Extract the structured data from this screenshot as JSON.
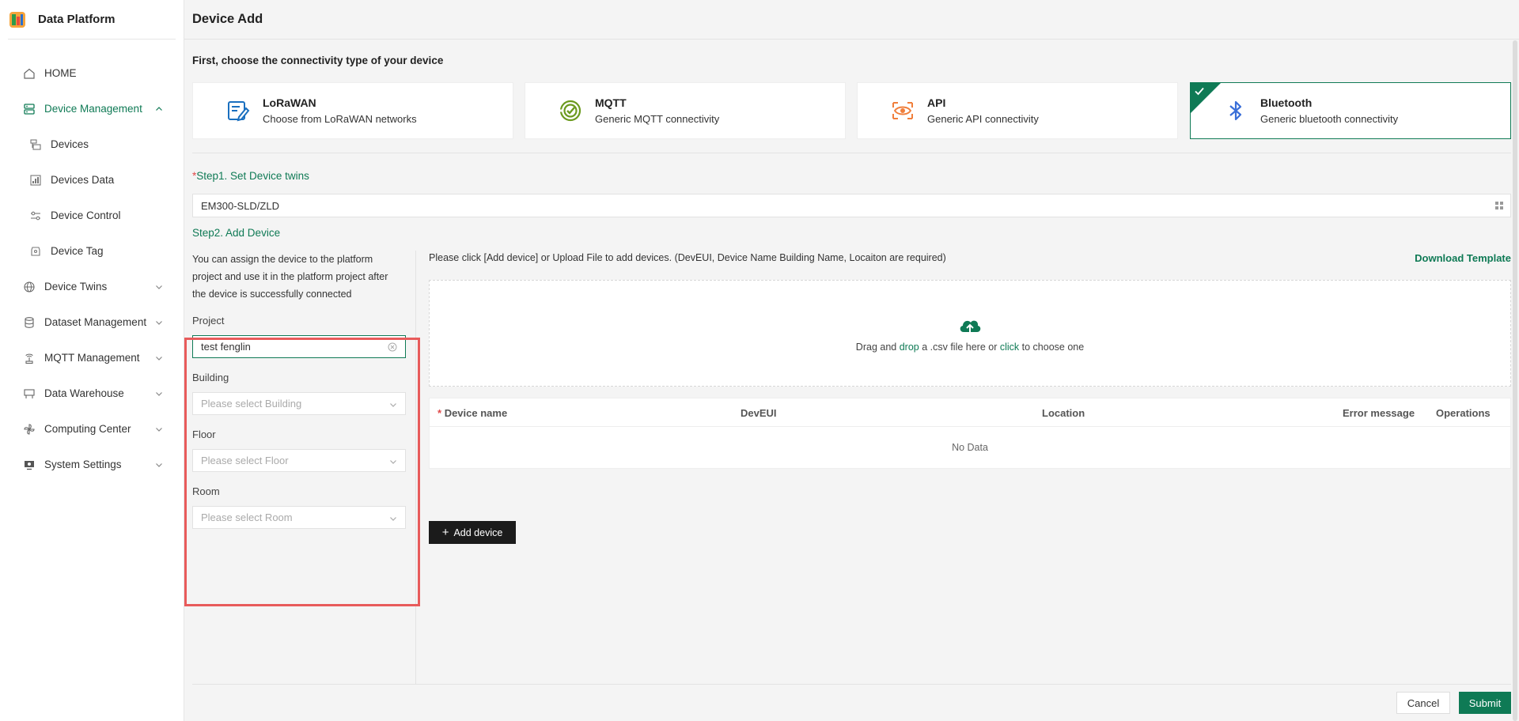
{
  "app": {
    "name": "Data Platform"
  },
  "sidebar": {
    "items": [
      {
        "label": "HOME",
        "icon": "home-icon"
      },
      {
        "label": "Device Management",
        "icon": "server-icon",
        "expanded": true
      },
      {
        "label": "Devices",
        "icon": "devices-icon"
      },
      {
        "label": "Devices Data",
        "icon": "data-icon"
      },
      {
        "label": "Device Control",
        "icon": "sliders-icon"
      },
      {
        "label": "Device Tag",
        "icon": "tag-icon"
      },
      {
        "label": "Device Twins",
        "icon": "globe-icon"
      },
      {
        "label": "Dataset Management",
        "icon": "database-icon"
      },
      {
        "label": "MQTT Management",
        "icon": "antenna-icon"
      },
      {
        "label": "Data Warehouse",
        "icon": "warehouse-icon"
      },
      {
        "label": "Computing Center",
        "icon": "pinwheel-icon"
      },
      {
        "label": "System Settings",
        "icon": "monitor-icon"
      }
    ]
  },
  "page": {
    "title": "Device Add"
  },
  "connectivity": {
    "heading": "First, choose the connectivity type of your device",
    "selected": "Bluetooth",
    "options": [
      {
        "name": "LoRaWAN",
        "desc": "Choose from LoRaWAN networks",
        "icon": "lorawan-icon",
        "color": "#1a6fbf"
      },
      {
        "name": "MQTT",
        "desc": "Generic MQTT connectivity",
        "icon": "mqtt-icon",
        "color": "#6b9a1e"
      },
      {
        "name": "API",
        "desc": "Generic API connectivity",
        "icon": "api-icon",
        "color": "#f07f3c"
      },
      {
        "name": "Bluetooth",
        "desc": "Generic bluetooth connectivity",
        "icon": "bluetooth-icon",
        "color": "#3a6fd8"
      }
    ]
  },
  "step1": {
    "required_mark": "*",
    "label": "Step1. Set Device twins",
    "value": "EM300-SLD/ZLD"
  },
  "step2": {
    "label": "Step2. Add Device",
    "note": "You can assign the device to the platform project and use it in the platform project after the device is successfully connected",
    "project": {
      "label": "Project",
      "value": "test fenglin"
    },
    "building": {
      "label": "Building",
      "placeholder": "Please select Building"
    },
    "floor": {
      "label": "Floor",
      "placeholder": "Please select Floor"
    },
    "room": {
      "label": "Room",
      "placeholder": "Please select Room"
    },
    "instructions": "Please click [Add device] or Upload File to add devices. (DevEUI, Device Name Building Name, Locaiton are required)",
    "download_label": "Download Template",
    "dropzone": {
      "text1": "Drag and ",
      "drop": "drop",
      "text2": " a .csv file here or ",
      "click": "click",
      "text3": " to choose one"
    },
    "table": {
      "columns": [
        "Device name",
        "DevEUI",
        "Location",
        "Error message",
        "Operations"
      ],
      "required_mark": "*",
      "empty": "No Data"
    },
    "add_button": "Add device"
  },
  "footer": {
    "cancel": "Cancel",
    "submit": "Submit"
  },
  "colors": {
    "primary": "#0f7a55",
    "highlight": "#e85b5b"
  }
}
